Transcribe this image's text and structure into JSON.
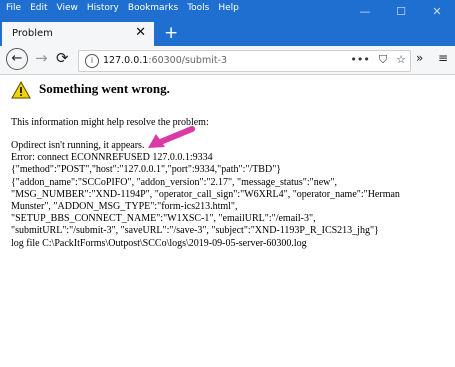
{
  "menu": [
    "File",
    "Edit",
    "View",
    "History",
    "Bookmarks",
    "Tools",
    "Help"
  ],
  "window_buttons": {
    "minimize": "—",
    "maximize": "☐",
    "close": "✕"
  },
  "tab": {
    "title": "Problem",
    "close": "✕",
    "new_tab": "+"
  },
  "nav": {
    "back": "←",
    "forward": "→",
    "reload": "⟳"
  },
  "url": {
    "host": "127.0.0.1",
    "path": ":60300/submit-3"
  },
  "url_icons": {
    "more": "•••",
    "pocket": "⛉",
    "star": "☆",
    "overflow": "»",
    "menu": "≡"
  },
  "page": {
    "heading": "Something went wrong.",
    "info": "This information might help resolve the problem:",
    "lines": [
      "Opdirect isn't running, it appears.",
      "Error: connect ECONNREFUSED 127.0.0.1:9334",
      "{\"method\":\"POST\",\"host\":\"127.0.0.1\",\"port\":9334,\"path\":\"/TBD\"}",
      "{\"addon_name\":\"SCCoPIFO\", \"addon_version\":\"2.17\", \"message_status\":\"new\",",
      "\"MSG_NUMBER\":\"XND-1194P\", \"operator_call_sign\":\"W6XRL4\", \"operator_name\":\"Herman",
      "Munster\", \"ADDON_MSG_TYPE\":\"form-ics213.html\",",
      "\"SETUP_BBS_CONNECT_NAME\":\"W1XSC-1\", \"emailURL\":\"/email-3\",",
      "\"submitURL\":\"/submit-3\", \"saveURL\":\"/save-3\", \"subject\":\"XND-1193P_R_ICS213_jhg\"}",
      "log file C:\\PackItForms\\Outpost\\SCCo\\logs\\2019-09-05-server-60300.log"
    ]
  },
  "colors": {
    "titlebar": "#1e6fd0",
    "arrow": "#d93aa6",
    "warning": "#f2d400"
  }
}
